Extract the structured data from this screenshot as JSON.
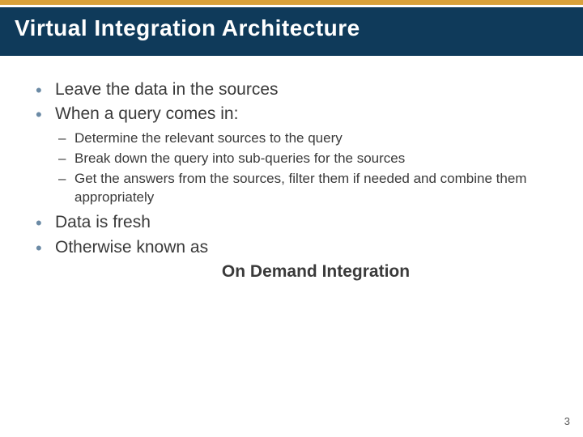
{
  "title": "Virtual Integration Architecture",
  "bullets": {
    "b0": "Leave the data in the sources",
    "b1": "When a query comes in:",
    "b1_sub": {
      "s0": "Determine the relevant sources to the query",
      "s1": "Break down the query into sub-queries for the sources",
      "s2": "Get the answers from the sources, filter them if needed and combine them appropriately"
    },
    "b2": "Data is fresh",
    "b3": "Otherwise known as"
  },
  "emphasis": "On Demand Integration",
  "page_number": "3",
  "colors": {
    "title_band": "#0f3a5a",
    "accent_band": "#d9a13a",
    "bullet_marker": "#6b8aa5",
    "body_text": "#3a3a3a"
  }
}
